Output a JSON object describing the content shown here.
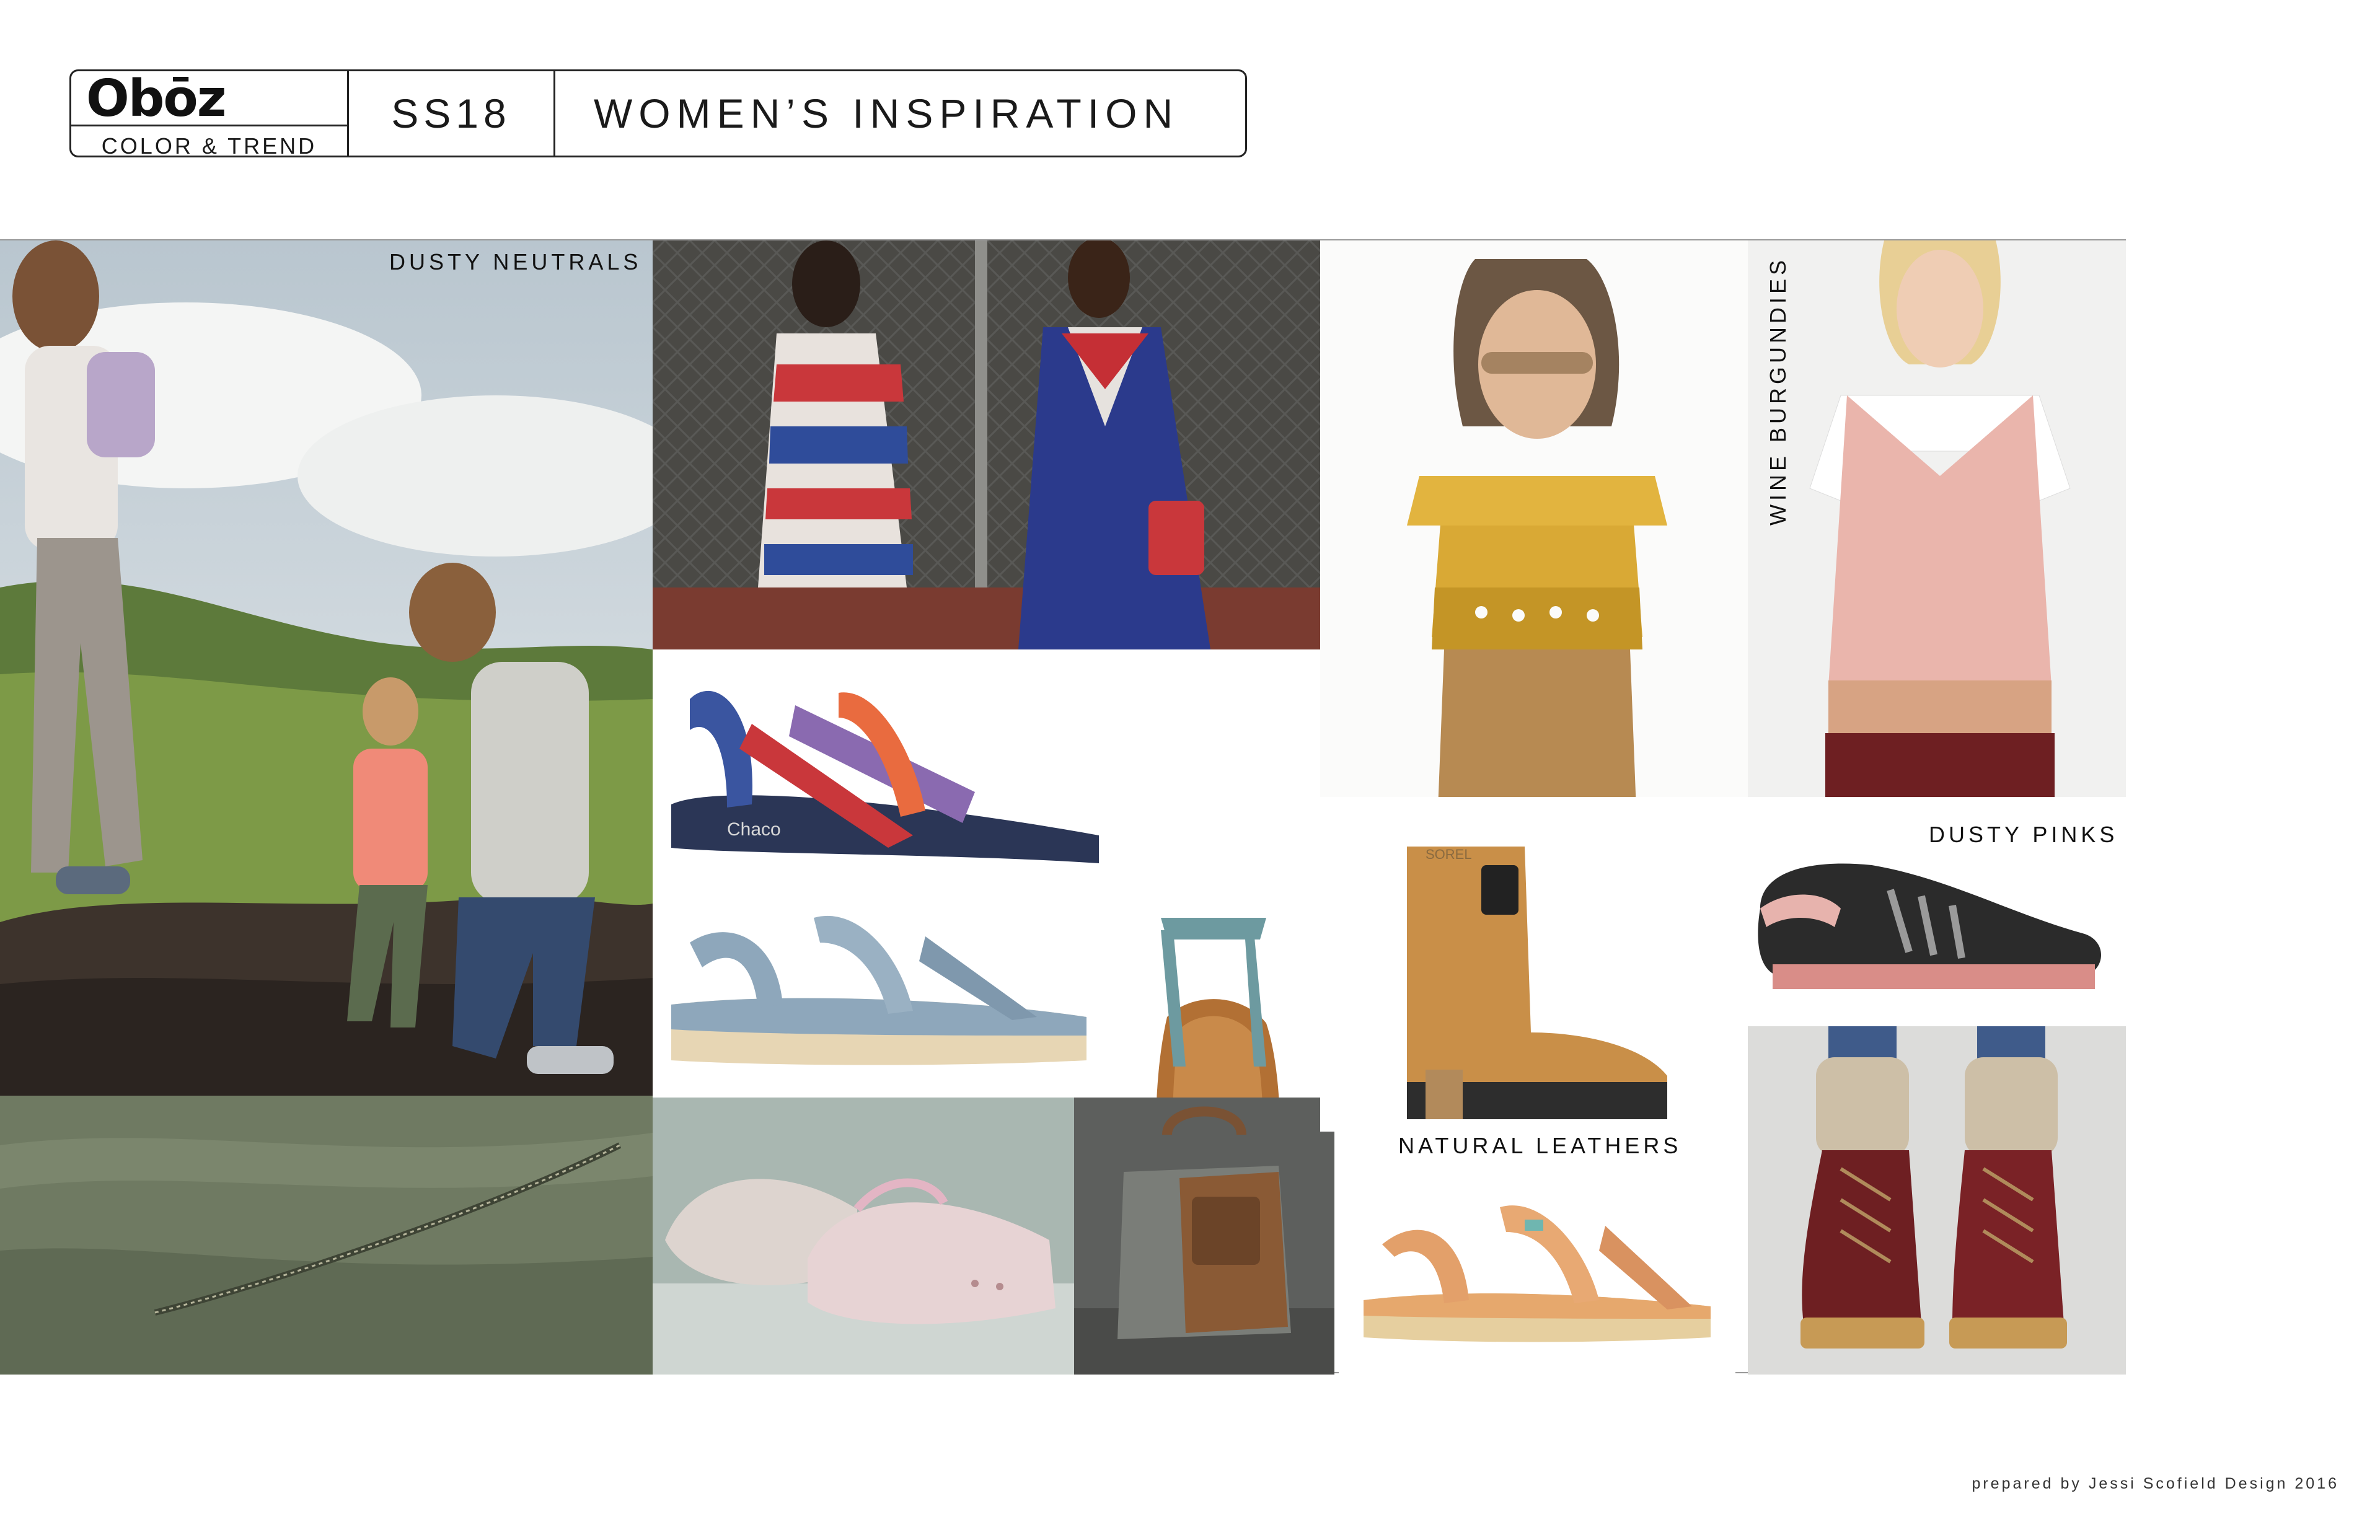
{
  "header": {
    "brand": "Obōz",
    "brand_subtitle": "COLOR & TREND",
    "season": "SS18",
    "title": "WOMEN’S INSPIRATION"
  },
  "labels": {
    "dusty_neutrals": "DUSTY NEUTRALS",
    "wine_burgundies": "WINE BURGUNDIES",
    "dusty_pinks": "DUSTY PINKS",
    "natural_leathers": "NATURAL LEATHERS"
  },
  "product_texts": {
    "sandal_brand": "Chaco",
    "boot_brand": "SOREL"
  },
  "footer": {
    "credit": "prepared by Jessi Scofield Design 2016"
  },
  "palette": {
    "dusty_neutral": "#a9a39a",
    "sage": "#6f7a62",
    "blush": "#e7b3ad",
    "burgundy": "#6e1f22",
    "tan_leather": "#c98a4a",
    "mustard": "#d9a935",
    "slate_blue": "#8ea7bb",
    "navy": "#2b3656"
  }
}
